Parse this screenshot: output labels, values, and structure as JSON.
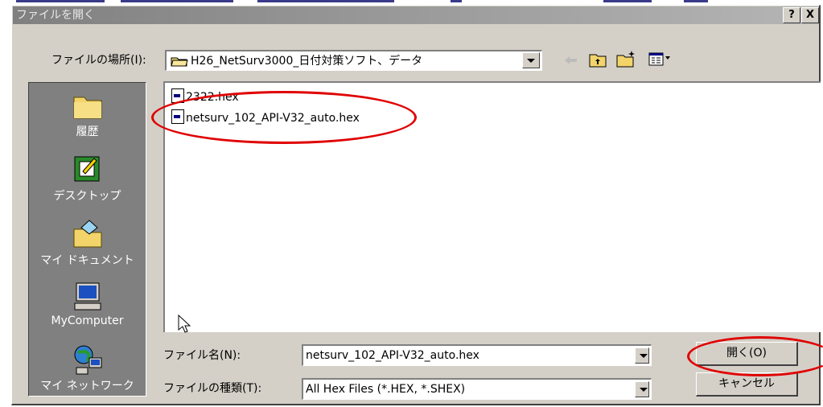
{
  "dialog": {
    "title": "ファイルを開く",
    "help_button": "?",
    "close_button": "X"
  },
  "location": {
    "label": "ファイルの場所(I):",
    "value": "H26_NetSurv3000_日付対策ソフト、データ"
  },
  "toolbar": {
    "back_icon": "back-arrow-icon",
    "up_icon": "up-folder-icon",
    "new_folder_icon": "new-folder-icon",
    "view_icon": "view-menu-icon"
  },
  "places": [
    {
      "label": "履歴",
      "icon": "history-folder-icon"
    },
    {
      "label": "デスクトップ",
      "icon": "desktop-icon"
    },
    {
      "label": "マイ ドキュメント",
      "icon": "my-documents-icon"
    },
    {
      "label": "MyComputer",
      "icon": "my-computer-icon"
    },
    {
      "label": "マイ ネットワーク",
      "icon": "my-network-icon"
    }
  ],
  "files": [
    {
      "name": "2322.hex"
    },
    {
      "name": "netsurv_102_API-V32_auto.hex"
    }
  ],
  "filename": {
    "label": "ファイル名(N):",
    "value": "netsurv_102_API-V32_auto.hex"
  },
  "filetype": {
    "label": "ファイルの種類(T):",
    "value": "All Hex Files (*.HEX, *.SHEX)"
  },
  "buttons": {
    "open": "開く(O)",
    "cancel": "キャンセル"
  },
  "colors": {
    "face": "#d4d0c8",
    "highlight_oval": "#e00000",
    "places_bar": "#808080"
  }
}
